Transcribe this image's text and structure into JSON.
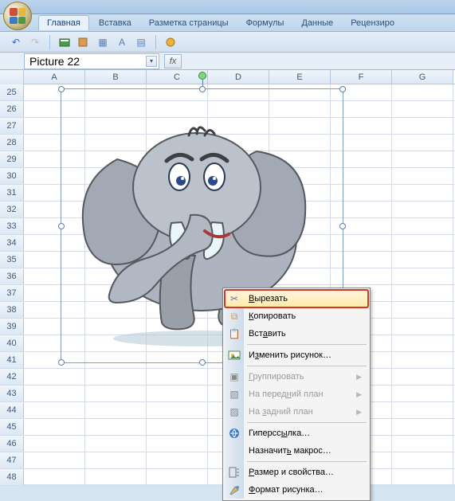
{
  "ribbon": {
    "tabs": [
      "Главная",
      "Вставка",
      "Разметка страницы",
      "Формулы",
      "Данные",
      "Рецензиро"
    ]
  },
  "namebox": {
    "value": "Picture 22",
    "fx_label": "fx"
  },
  "columns": [
    "A",
    "B",
    "C",
    "D",
    "E",
    "F",
    "G"
  ],
  "row_start": 25,
  "row_end": 48,
  "context_menu": {
    "cut": "Вырезать",
    "copy": "Копировать",
    "paste": "Вставить",
    "change_picture": "Изменить рисунок…",
    "group": "Группировать",
    "bring_front": "На передний план",
    "send_back": "На задний план",
    "hyperlink": "Гиперссылка…",
    "assign_macro": "Назначить макрос…",
    "size_props": "Размер и свойства…",
    "format_picture": "Формат рисунка…"
  }
}
